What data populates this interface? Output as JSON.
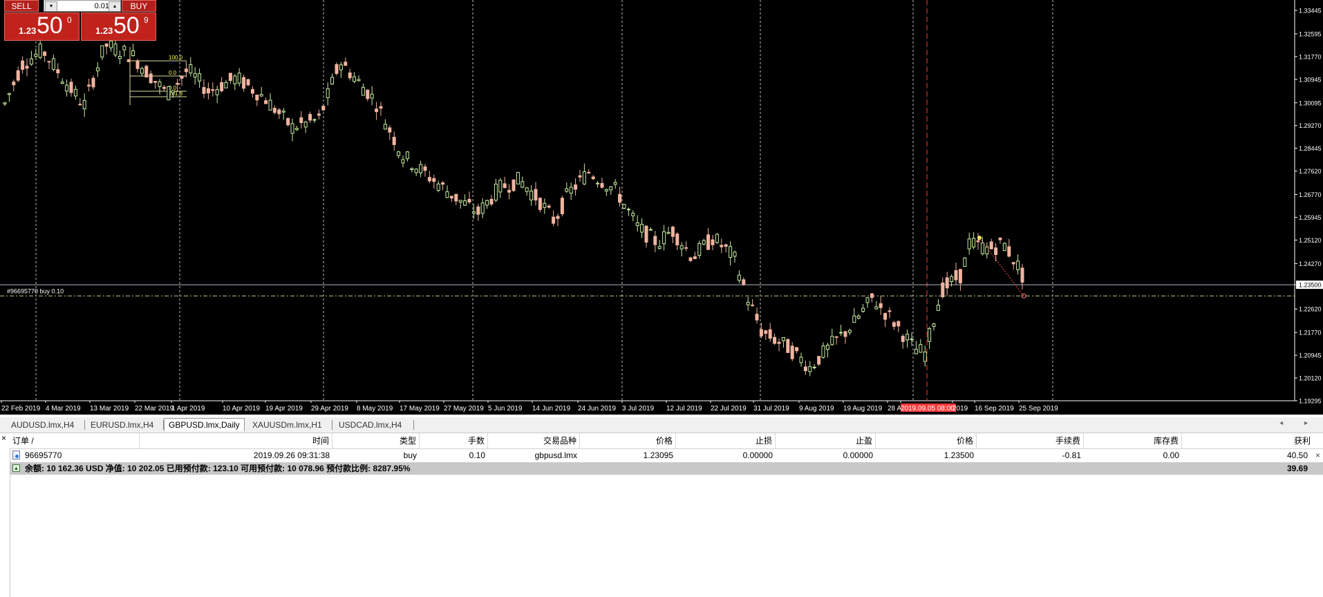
{
  "one_click": {
    "sell_label": "SELL",
    "buy_label": "BUY",
    "lot": "0.01",
    "sell_price_small": "1.23",
    "sell_price_big": "50",
    "sell_price_sup": "0",
    "buy_price_small": "1.23",
    "buy_price_big": "50",
    "buy_price_sup": "9",
    "down_icon": "triangle-down-icon",
    "up_icon": "triangle-up-icon"
  },
  "chart": {
    "colors": {
      "background": "#000000",
      "bull": "#c8f0a0",
      "bear": "#f0b4a0",
      "grid": "#c0c0c0",
      "sell_line": "#b0b8c8",
      "order_line": "#8a8a5a",
      "vline": "#ff3a3a"
    },
    "order_label": "#96695770 buy 0.10",
    "price_labels": [
      "1.33445",
      "1.32595",
      "1.31770",
      "1.30945",
      "1.30095",
      "1.29270",
      "1.28445",
      "1.27620",
      "1.26770",
      "1.25945",
      "1.25120",
      "1.24270",
      "1.23500",
      "1.22620",
      "1.21770",
      "1.20945",
      "1.20120",
      "1.19295"
    ],
    "date_labels": [
      "22 Feb 2019",
      "4 Mar 2019",
      "13 Mar 2019",
      "22 Mar 2019",
      "1 Apr 2019",
      "10 Apr 2019",
      "19 Apr 2019",
      "29 Apr 2019",
      "8 May 2019",
      "17 May 2019",
      "27 May 2019",
      "5 Jun 2019",
      "14 Jun 2019",
      "24 Jun 2019",
      "3 Jul 2019",
      "12 Jul 2019",
      "22 Jul 2019",
      "31 Jul 2019",
      "9 Aug 2019",
      "19 Aug 2019",
      "28 Aug 2019",
      "2019.09.05 08:00",
      "2019",
      "16 Sep 2019",
      "25 Sep 2019"
    ],
    "fib_labels": [
      "100.0",
      "0.0",
      "0.0",
      "161.8"
    ],
    "current_price": "1.23500",
    "vline_label": "2019.09.05 08:00"
  },
  "tabs": [
    "AUDUSD.lmx,H4",
    "EURUSD.lmx,H4",
    "GBPUSD.lmx,Daily",
    "XAUUSDm.lmx,H1",
    "USDCAD.lmx,H4"
  ],
  "active_tab": 2,
  "scroll_arrows": "◂ ▸",
  "terminal": {
    "close": "×",
    "headers": [
      "订单 /",
      "时间",
      "类型",
      "手数",
      "交易品种",
      "价格",
      "止损",
      "止盈",
      "价格",
      "手续费",
      "库存费",
      "获利"
    ],
    "order": {
      "ticket": "96695770",
      "time": "2019.09.26 09:31:38",
      "type": "buy",
      "lots": "0.10",
      "symbol": "gbpusd.lmx",
      "open_price": "1.23095",
      "sl": "0.00000",
      "tp": "0.00000",
      "price": "1.23500",
      "commission": "-0.81",
      "swap": "0.00",
      "profit": "40.50",
      "close": "×"
    },
    "summary": "余额: 10 162.36 USD  净值: 10 202.05  已用预付款: 123.10  可用预付款: 10 078.96  预付款比例: 8287.95%",
    "summary_profit": "39.69"
  }
}
